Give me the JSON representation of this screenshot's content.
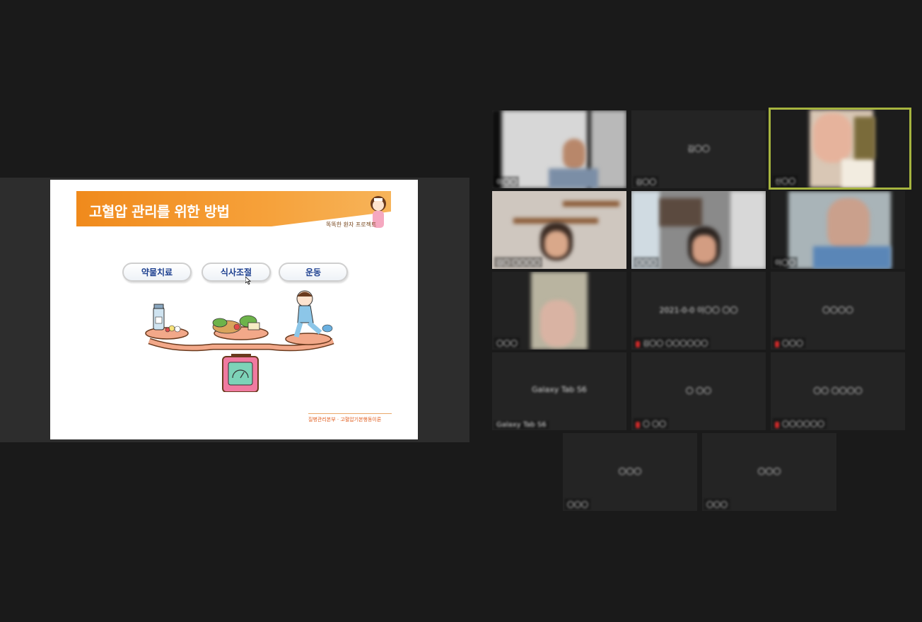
{
  "slide": {
    "title": "고혈압 관리를 위한 방법",
    "subtitle": "똑똑한 환자 프로젝트",
    "options": [
      "약물치료",
      "식사조절",
      "운동"
    ],
    "footer": "질병관리본부 · 고혈압기본행동이론"
  },
  "gallery": [
    {
      "label": "이〇〇"
    },
    {
      "center_name": "김〇〇",
      "label": "김〇〇"
    },
    {
      "label": "신〇〇"
    },
    {
      "label": "김〇 〇〇〇〇"
    },
    {
      "label": "〇〇〇"
    },
    {
      "label": "이〇〇"
    },
    {
      "label": "〇〇〇"
    },
    {
      "center_name": "2021-0-0 이〇〇 〇〇",
      "label": "김〇〇 〇〇〇〇〇〇"
    },
    {
      "center_name": "〇〇〇〇",
      "label": "〇〇〇"
    },
    {
      "center_name": "Galaxy Tab S6",
      "label": "Galaxy Tab S6"
    },
    {
      "center_name": "〇 〇〇",
      "label": "〇 〇〇"
    },
    {
      "center_name": "〇〇 〇〇〇〇",
      "label": "〇〇〇〇〇〇"
    },
    {
      "center_name": "〇〇〇",
      "label": "〇〇〇"
    },
    {
      "center_name": "〇〇〇",
      "label": "〇〇〇"
    }
  ],
  "colors": {
    "background": "#1a1a1a",
    "tile": "#242424",
    "active_speaker_border": "#a6b43f",
    "slide_banner": "#f08a1c",
    "muted_mic": "#d02a2a"
  }
}
